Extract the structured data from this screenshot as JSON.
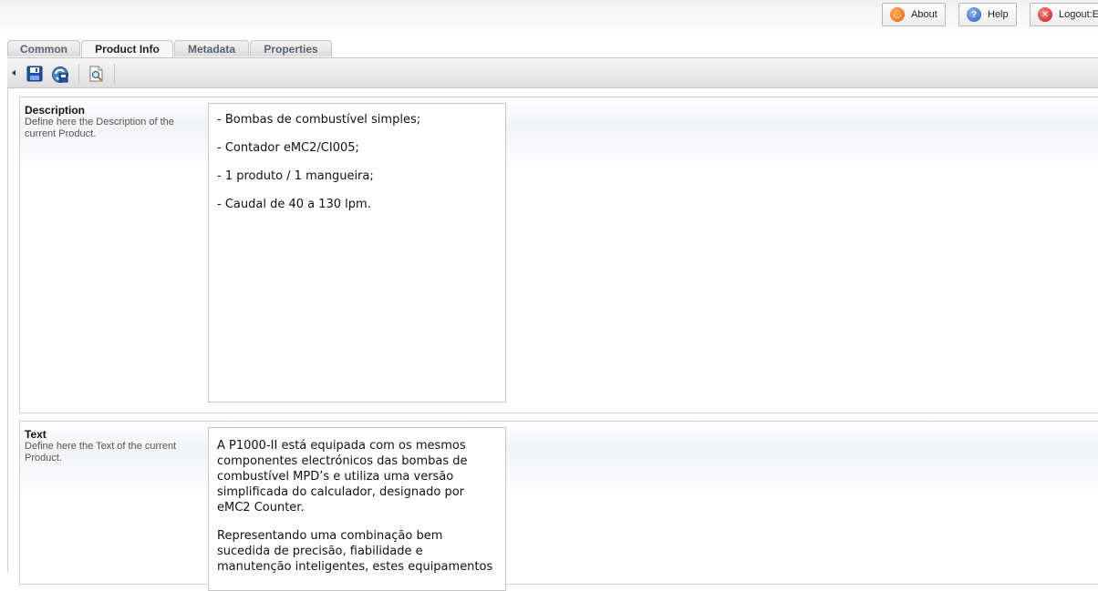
{
  "topbar": {
    "buttons": [
      {
        "id": "about",
        "label": "About",
        "icon": "about-icon"
      },
      {
        "id": "help",
        "label": "Help",
        "icon": "help-icon"
      },
      {
        "id": "logout",
        "label": "Logout:E",
        "icon": "logout-icon"
      }
    ]
  },
  "tabs": [
    {
      "label": "Common",
      "active": false
    },
    {
      "label": "Product Info",
      "active": true
    },
    {
      "label": "Metadata",
      "active": false
    },
    {
      "label": "Properties",
      "active": false
    }
  ],
  "toolbar": {
    "icons": [
      "collapse-arrow-icon",
      "save-icon",
      "save-refresh-icon",
      "preview-icon"
    ]
  },
  "description": {
    "title": "Description",
    "hint": "Define here the Description of the current Product.",
    "lines": [
      "- Bombas de combustível simples;",
      "- Contador eMC2/CI005;",
      "- 1 produto / 1 mangueira;",
      "- Caudal de 40 a 130 lpm."
    ]
  },
  "text": {
    "title": "Text",
    "hint": "Define here the Text of the current Product.",
    "paragraphs": [
      "A P1000-II está equipada com os mesmos componentes electrónicos das bombas de combustível MPD’s e utiliza uma versão simplificada do calculador, designado por eMC2 Counter.",
      "Representando uma combinação bem sucedida de precisão, fiabilidade e manutenção inteligentes, estes equipamentos"
    ]
  }
}
